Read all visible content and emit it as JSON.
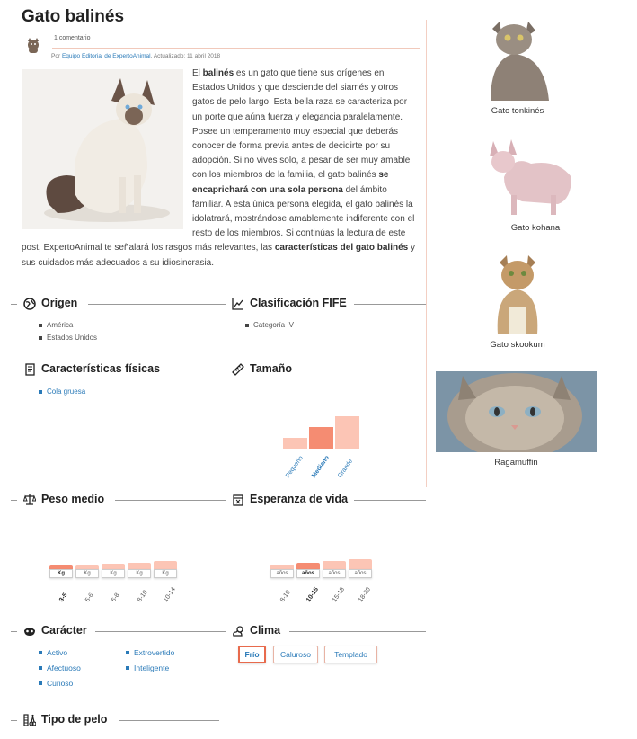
{
  "article": {
    "title": "Gato balinés",
    "comments": "1 comentario",
    "author_prefix": "Por",
    "author": "Equipo Editorial de ExpertoAnimal",
    "updated": ". Actualizado: 11 abril 2018",
    "intro_parts": [
      {
        "t": "El ",
        "b": false
      },
      {
        "t": "balinés",
        "b": true
      },
      {
        "t": " es un gato que tiene sus orígenes en Estados Unidos y que desciende del siamés y otros gatos de pelo largo. Esta bella raza se caracteriza por un porte que aúna fuerza y elegancia paralelamente. Posee un temperamento muy especial que deberás conocer de forma previa antes de decidirte por su adopción. Si no vives solo, a pesar de ser muy amable con los miembros de la familia, el gato balinés ",
        "b": false
      },
      {
        "t": "se encaprichará con una sola persona",
        "b": true
      },
      {
        "t": " del ámbito familiar. A esta única persona elegida, el gato balinés la idolatrará, mostrándose amablemente indiferente con el resto de los miembros. Si continúas la lectura de este post, ExpertoAnimal te señalará los rasgos más relevantes, las ",
        "b": false
      },
      {
        "t": "características del gato balinés",
        "b": true
      },
      {
        "t": " y sus cuidados más adecuados a su idiosincrasia.",
        "b": false
      }
    ]
  },
  "sections": {
    "origen": {
      "title": "Origen",
      "items": [
        "América",
        "Estados Unidos"
      ]
    },
    "fife": {
      "title": "Clasificación FIFE",
      "items": [
        "Categoría IV"
      ]
    },
    "fisicas": {
      "title": "Características físicas",
      "items": [
        "Cola gruesa"
      ]
    },
    "tamano": {
      "title": "Tamaño",
      "options": [
        "Pequeño",
        "Mediano",
        "Grande"
      ],
      "selected": "Mediano",
      "levels": [
        0.3,
        0.6,
        0.9
      ]
    },
    "peso": {
      "title": "Peso medio",
      "unit": "Kg",
      "options": [
        "3-5",
        "5-6",
        "6-8",
        "8-10",
        "10-14"
      ],
      "selected": "3-5"
    },
    "esperanza": {
      "title": "Esperanza de vida",
      "unit": "años",
      "options": [
        "8-10",
        "10-15",
        "15-18",
        "18-20"
      ],
      "selected": "10-15"
    },
    "caracter": {
      "title": "Carácter",
      "col1": [
        "Activo",
        "Afectuoso",
        "Curioso"
      ],
      "col2": [
        "Extrovertido",
        "Inteligente"
      ]
    },
    "clima": {
      "title": "Clima",
      "options": [
        "Frío",
        "Caluroso",
        "Templado"
      ],
      "selected": "Frío"
    },
    "pelo": {
      "title": "Tipo de pelo"
    }
  },
  "related": [
    {
      "name": "Gato tonkinés"
    },
    {
      "name": "Gato kohana"
    },
    {
      "name": "Gato skookum"
    },
    {
      "name": "Ragamuffin"
    }
  ],
  "colors": {
    "accent": "#f58c72",
    "accent_light": "#fcc5b5",
    "link": "#2a7ab8",
    "divider": "#f3cfc3"
  }
}
